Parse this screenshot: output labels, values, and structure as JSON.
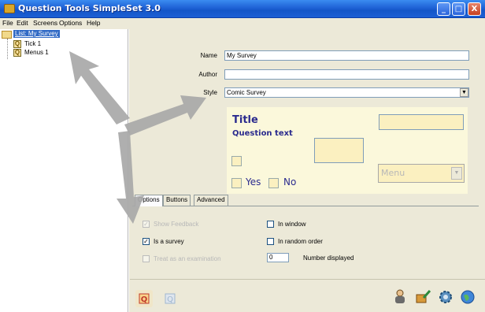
{
  "window": {
    "title": "Question Tools SimpleSet 3.0",
    "controls": {
      "minimize": "_",
      "maximize": "□",
      "close": "X"
    }
  },
  "menu": [
    "File",
    "Edit",
    "Screens",
    "Options",
    "Help"
  ],
  "tree": {
    "root": "List: My Survey",
    "items": [
      "Tick 1",
      "Menus 1"
    ],
    "item_icon": "Q"
  },
  "form": {
    "name_label": "Name",
    "name_value": "My Survey",
    "author_label": "Author",
    "author_value": "",
    "style_label": "Style",
    "style_value": "Comic Survey",
    "dropdown_arrow": "▼"
  },
  "preview": {
    "title": "Title",
    "question_text": "Question text",
    "yes": "Yes",
    "no": "No",
    "menu": "Menu",
    "menu_arrow": "▼"
  },
  "tabs": [
    "Options",
    "Buttons",
    "Advanced"
  ],
  "options": {
    "show_feedback": {
      "label": "Show Feedback",
      "checked": true,
      "enabled": false
    },
    "is_a_survey": {
      "label": "Is a survey",
      "checked": true,
      "enabled": true
    },
    "treat_as_exam": {
      "label": "Treat as an examination",
      "checked": false,
      "enabled": false
    },
    "in_window": {
      "label": "In window",
      "checked": false,
      "enabled": true
    },
    "in_random_order": {
      "label": "In random order",
      "checked": false,
      "enabled": true
    },
    "number_displayed": {
      "label": "Number displayed",
      "value": "0"
    },
    "check_mark": "✓"
  },
  "toolbar_icons": [
    "question-icon",
    "disabled-question-icon",
    "people-icon",
    "paintbrush-icon",
    "gear-icon",
    "globe-icon"
  ],
  "colors": {
    "titlebar": "#1f62d6",
    "selection": "#316ac5",
    "preview_bg": "#fbf8db",
    "preview_text": "#2b2b8e",
    "arrow": "#a8a8a8"
  }
}
